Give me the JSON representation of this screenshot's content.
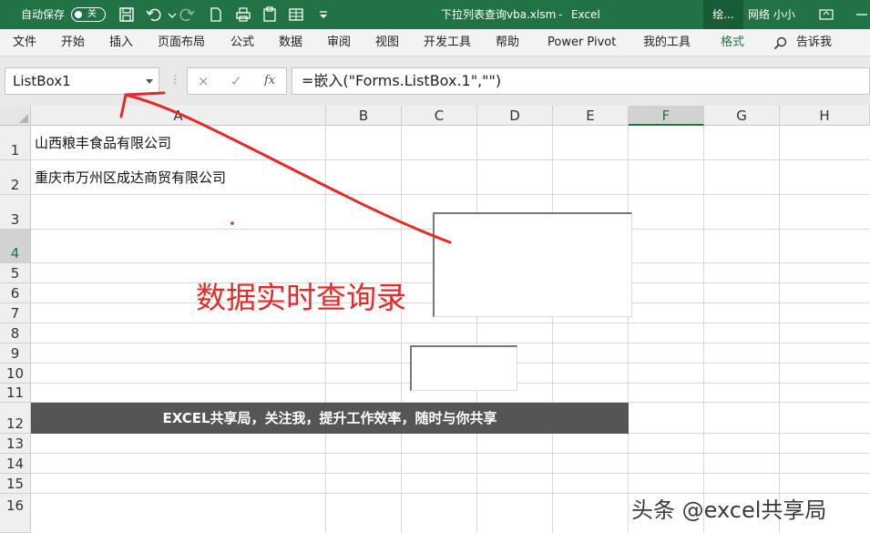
{
  "titlebar": {
    "autosave_label": "自动保存",
    "autosave_state": "关",
    "filename": "下拉列表查询vba.xlsm",
    "separator": "-",
    "app": "Excel",
    "draw_tab": "绘...",
    "user": "网络 小小",
    "accent_color": "#217346"
  },
  "ribbon": {
    "tabs": [
      "文件",
      "开始",
      "插入",
      "页面布局",
      "公式",
      "数据",
      "审阅",
      "视图",
      "开发工具",
      "帮助",
      "Power Pivot",
      "我的工具",
      "格式"
    ],
    "selected_tab": "格式",
    "tell_me": "告诉我"
  },
  "formula_bar": {
    "name_box": "ListBox1",
    "cancel_symbol": "×",
    "enter_symbol": "✓",
    "fx_symbol": "fx",
    "formula": "=嵌入(\"Forms.ListBox.1\",\"\")"
  },
  "sheet": {
    "columns": [
      "A",
      "B",
      "C",
      "D",
      "E",
      "F",
      "G",
      "H"
    ],
    "selected_column": "F",
    "rows": [
      "1",
      "2",
      "3",
      "4",
      "5",
      "6",
      "7",
      "8",
      "9",
      "10",
      "11",
      "12",
      "13",
      "14",
      "15",
      "16"
    ],
    "selected_row": "4",
    "cells": {
      "A1": "山西粮丰食品有限公司",
      "A2": "重庆市万州区成达商贸有限公司"
    },
    "banner": "EXCEL共享局，关注我，提升工作效率，随时与你共享"
  },
  "annotation": {
    "text": "数据实时查询录",
    "color": "#e52a2a"
  },
  "watermark": "头条 @excel共享局"
}
